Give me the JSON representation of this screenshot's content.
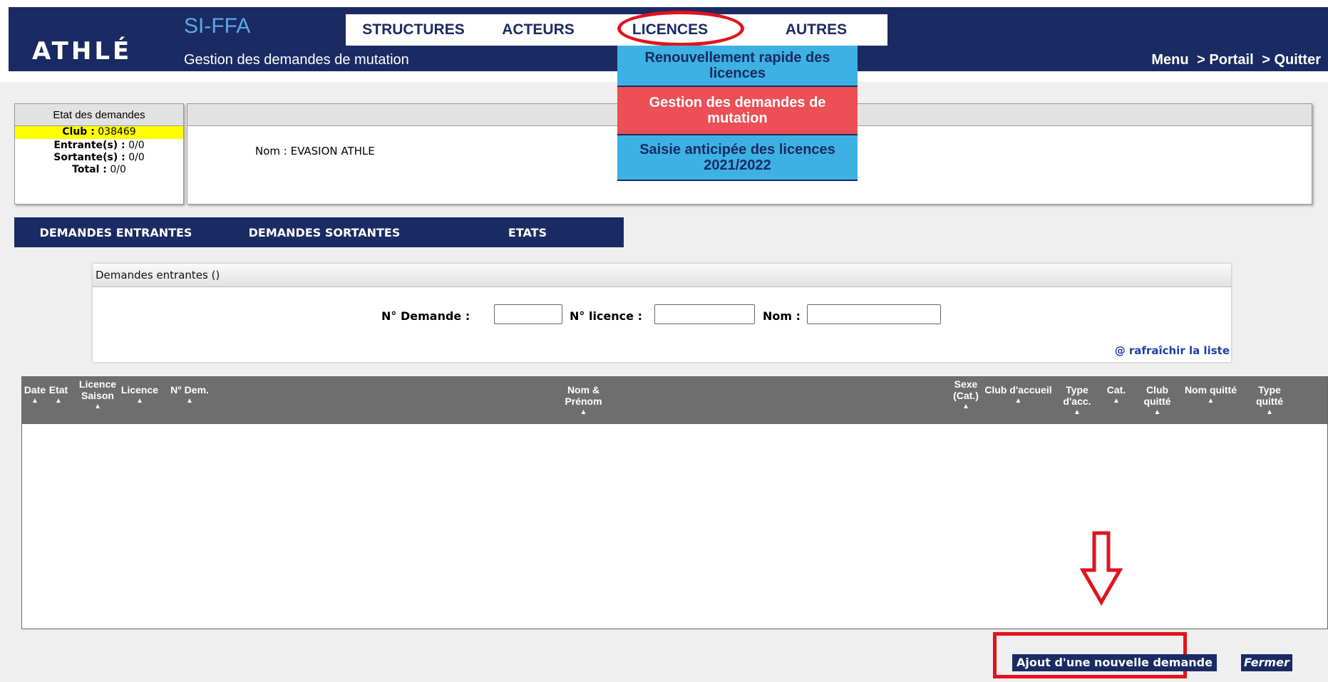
{
  "header": {
    "logo": "ATHLÉ",
    "app_title": "SI-FFA",
    "subtitle": "Gestion des demandes de mutation",
    "nav": [
      "STRUCTURES",
      "ACTEURS",
      "LICENCES",
      "AUTRES"
    ],
    "right_links": [
      "Menu",
      "> Portail",
      "> Quitter"
    ]
  },
  "dropdown": [
    "Renouvellement rapide des licences",
    "Gestion des demandes de mutation",
    "Saisie anticipée des licences 2021/2022"
  ],
  "etat": {
    "title": "Etat des demandes",
    "club_label": "Club :",
    "club_value": "038469",
    "entrantes_label": "Entrante(s) :",
    "entrantes_value": "0/0",
    "sortantes_label": "Sortante(s) :",
    "sortantes_value": "0/0",
    "total_label": "Total :",
    "total_value": "0/0"
  },
  "club_info": "Nom : EVASION ATHLE",
  "tabs": [
    "DEMANDES ENTRANTES",
    "DEMANDES SORTANTES",
    "ETATS"
  ],
  "search": {
    "title": "Demandes entrantes ()",
    "num_label": "N° Demande :",
    "lic_label": "N° licence :",
    "nom_label": "Nom :",
    "refresh": "@ rafraîchir la liste"
  },
  "table": {
    "columns": [
      "Date",
      "Etat",
      "Licence Saison",
      "Licence",
      "N° Dem.",
      "Nom & Prénom",
      "Sexe (Cat.)",
      "Club d'accueil",
      "Type d'acc.",
      "Cat.",
      "Club quitté",
      "Nom quitté",
      "Type quitté"
    ],
    "sort_glyph": "▲"
  },
  "actions": {
    "add": "Ajout d'une nouvelle demande",
    "close": "Fermer"
  }
}
